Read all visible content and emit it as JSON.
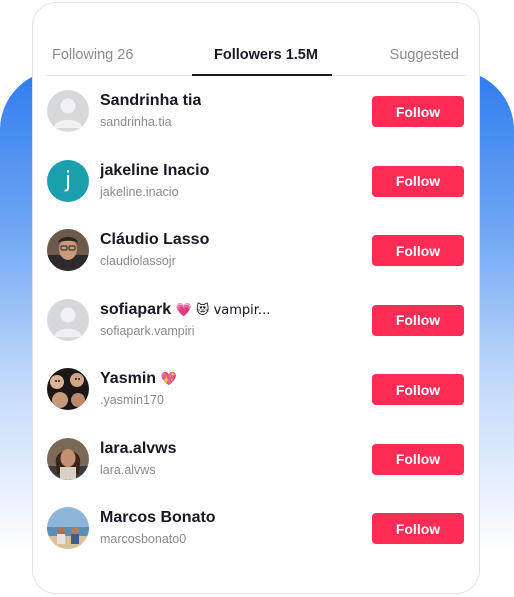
{
  "tabs": {
    "following": "Following 26",
    "followers": "Followers 1.5M",
    "suggested": "Suggested"
  },
  "followers": [
    {
      "name": "Sandrinha tia",
      "handle": "sandrinha.tia",
      "avatar": "default-avatar-icon",
      "follow_label": "Follow"
    },
    {
      "name": "jakeline Inacio",
      "handle": "jakeline.inacio",
      "avatar": "letter-avatar",
      "avatar_letter": "j",
      "avatar_color": "#1aa0ad",
      "follow_label": "Follow"
    },
    {
      "name": "Cláudio Lasso",
      "handle": "claudiolassojr",
      "avatar": "photo-avatar",
      "follow_label": "Follow"
    },
    {
      "name": "sofiapark",
      "name_suffix": "💗 😻 vampir...",
      "handle": "sofiapark.vampiri",
      "avatar": "default-avatar-icon",
      "follow_label": "Follow"
    },
    {
      "name": "Yasmin",
      "name_suffix": "💖",
      "handle": ".yasmin170",
      "avatar": "photo-avatar",
      "follow_label": "Follow"
    },
    {
      "name": "lara.alvws",
      "handle": "lara.alvws",
      "avatar": "photo-avatar",
      "follow_label": "Follow"
    },
    {
      "name": "Marcos Bonato",
      "handle": "marcosbonato0",
      "avatar": "photo-avatar",
      "follow_label": "Follow"
    }
  ],
  "colors": {
    "follow_button": "#fe2c55",
    "text_primary": "#161823",
    "text_secondary": "#8a8b91",
    "background_accent": "#2f7cf0"
  }
}
